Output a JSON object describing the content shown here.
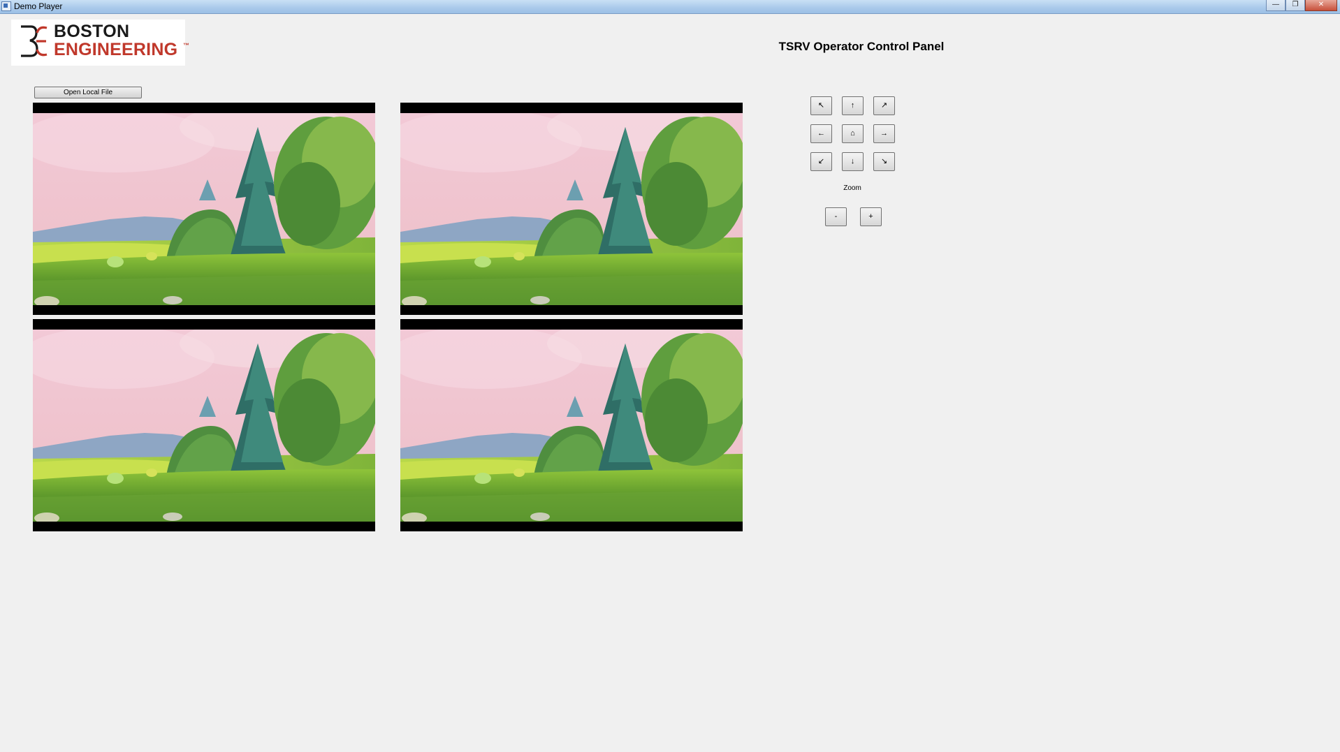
{
  "window": {
    "title": "Demo Player",
    "controls": {
      "minimize": "—",
      "maximize": "❐",
      "close": "✕"
    }
  },
  "logo": {
    "line1": "BOSTON",
    "line2": "ENGINEERING",
    "tm": "™"
  },
  "toolbar": {
    "open_label": "Open Local File"
  },
  "panel": {
    "title": "TSRV Operator Control Panel",
    "ptz": {
      "up_left": "↖",
      "up": "↑",
      "up_right": "↗",
      "left": "←",
      "home": "⌂",
      "right": "→",
      "down_left": "↙",
      "down": "↓",
      "down_right": "↘"
    },
    "zoom_label": "Zoom",
    "zoom_out": "-",
    "zoom_in": "+"
  },
  "videos": [
    {
      "icon": "video-frame-icon"
    },
    {
      "icon": "video-frame-icon"
    },
    {
      "icon": "video-frame-icon"
    },
    {
      "icon": "video-frame-icon"
    }
  ],
  "colors": {
    "brand_red": "#c0382b",
    "brand_dark": "#1a1a1a",
    "background": "#f0f0f0"
  }
}
